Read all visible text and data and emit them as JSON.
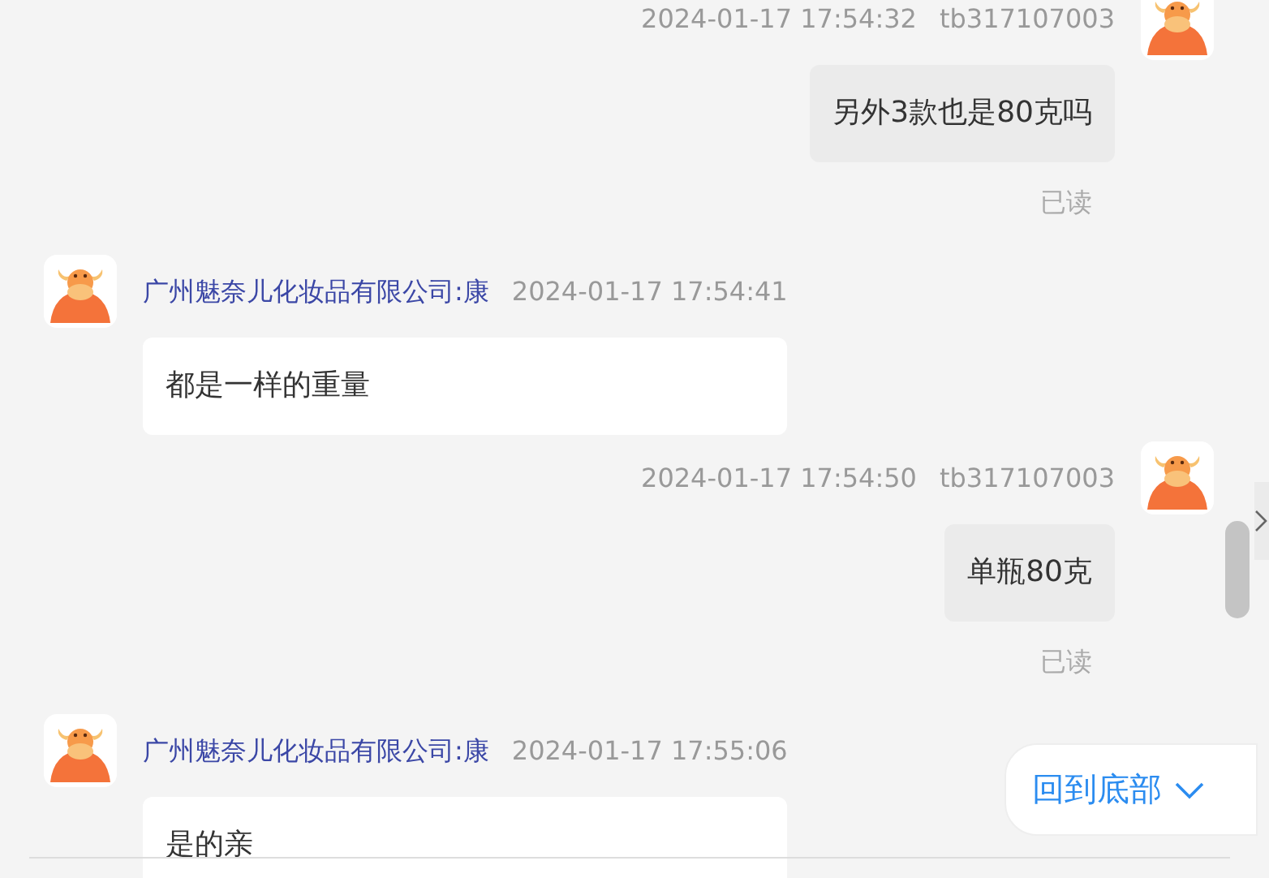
{
  "messages": [
    {
      "kind": "sent",
      "time": "2024-01-17 17:54:32",
      "sender": "tb317107003",
      "text": "另外3款也是80克吗",
      "status": "已读"
    },
    {
      "kind": "received",
      "sender": "广州魅奈儿化妆品有限公司:康",
      "time": "2024-01-17 17:54:41",
      "text": "都是一样的重量"
    },
    {
      "kind": "sent",
      "time": "2024-01-17 17:54:50",
      "sender": "tb317107003",
      "text": "单瓶80克",
      "status": "已读"
    },
    {
      "kind": "received",
      "sender": "广州魅奈儿化妆品有限公司:康",
      "time": "2024-01-17 17:55:06",
      "text": "是的亲"
    }
  ],
  "scroll_to_bottom": {
    "label": "回到底部"
  }
}
